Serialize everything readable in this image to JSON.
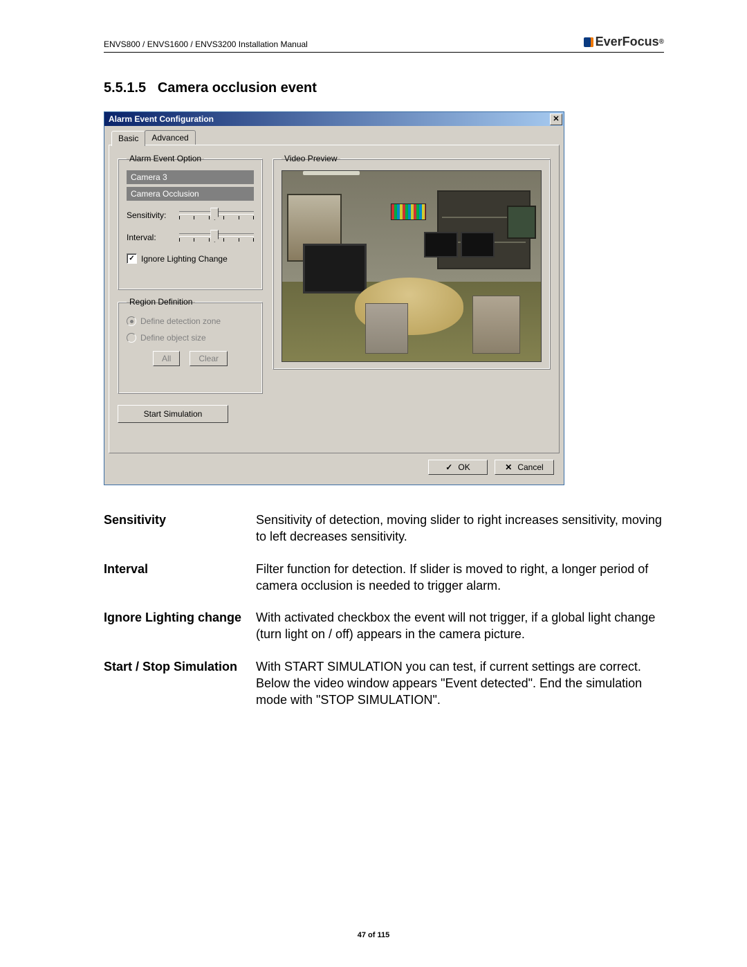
{
  "header": {
    "docId": "ENVS800 / ENVS1600 / ENVS3200 Installation Manual",
    "brand": "EverFocus"
  },
  "section": {
    "number": "5.5.1.5",
    "title": "Camera occlusion event"
  },
  "dialog": {
    "title": "Alarm Event Configuration",
    "tabs": {
      "basic": "Basic",
      "advanced": "Advanced"
    },
    "alarmOption": {
      "legend": "Alarm Event Option",
      "camera": "Camera 3",
      "eventType": "Camera Occlusion",
      "sensitivityLabel": "Sensitivity:",
      "intervalLabel": "Interval:",
      "ignoreLightingLabel": "Ignore Lighting Change",
      "ignoreLightingChecked": "✓"
    },
    "region": {
      "legend": "Region Definition",
      "detZone": "Define detection zone",
      "objSize": "Define object size",
      "all": "All",
      "clear": "Clear"
    },
    "startSim": "Start Simulation",
    "preview": {
      "legend": "Video Preview"
    },
    "ok": "OK",
    "cancel": "Cancel"
  },
  "desc": {
    "sensitivity": {
      "term": "Sensitivity",
      "def": "Sensitivity of detection, moving slider to right increases sensitivity, moving to left decreases sensitivity."
    },
    "interval": {
      "term": "Interval",
      "def": "Filter function for detection.  If slider is moved to right, a longer period of camera occlusion  is needed to trigger alarm."
    },
    "ignore": {
      "term": "Ignore Lighting change",
      "def": "With activated checkbox the event will not trigger, if a global light change (turn light on / off) appears in the camera picture."
    },
    "startstop": {
      "term": "Start / Stop Simulation",
      "def": "With START SIMULATION you can test, if current settings are correct.\nBelow the video window appears \"Event detected\". End the simulation mode with \"STOP SIMULATION\"."
    }
  },
  "footer": {
    "page": "47 of 115"
  }
}
